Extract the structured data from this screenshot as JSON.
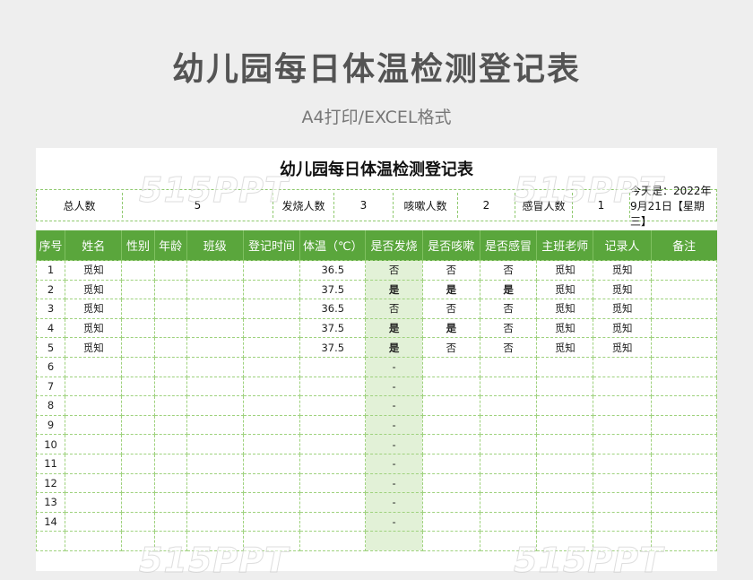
{
  "header": {
    "main_title": "幼儿园每日体温检测登记表",
    "sub_title": "A4打印/EXCEL格式"
  },
  "sheet": {
    "title": "幼儿园每日体温检测登记表",
    "summary": {
      "total_label": "总人数",
      "total_value": "5",
      "fever_label": "发烧人数",
      "fever_value": "3",
      "cough_label": "咳嗽人数",
      "cough_value": "2",
      "cold_label": "感冒人数",
      "cold_value": "1",
      "today_text": "今天是：2022年9月21日【星期三】"
    },
    "columns": [
      "序号",
      "姓名",
      "性别",
      "年龄",
      "班级",
      "登记时间",
      "体温（℃）",
      "是否发烧",
      "是否咳嗽",
      "是否感冒",
      "主班老师",
      "记录人",
      "备注"
    ],
    "rows": [
      {
        "no": "1",
        "name": "觅知",
        "gender": "",
        "age": "",
        "class": "",
        "time": "",
        "temp": "36.5",
        "fever": "否",
        "cough": "否",
        "cold": "否",
        "teacher": "觅知",
        "recorder": "觅知",
        "note": ""
      },
      {
        "no": "2",
        "name": "觅知",
        "gender": "",
        "age": "",
        "class": "",
        "time": "",
        "temp": "37.5",
        "fever": "是",
        "cough": "是",
        "cold": "是",
        "teacher": "觅知",
        "recorder": "觅知",
        "note": ""
      },
      {
        "no": "3",
        "name": "觅知",
        "gender": "",
        "age": "",
        "class": "",
        "time": "",
        "temp": "36.5",
        "fever": "否",
        "cough": "否",
        "cold": "否",
        "teacher": "觅知",
        "recorder": "觅知",
        "note": ""
      },
      {
        "no": "4",
        "name": "觅知",
        "gender": "",
        "age": "",
        "class": "",
        "time": "",
        "temp": "37.5",
        "fever": "是",
        "cough": "是",
        "cold": "否",
        "teacher": "觅知",
        "recorder": "觅知",
        "note": ""
      },
      {
        "no": "5",
        "name": "觅知",
        "gender": "",
        "age": "",
        "class": "",
        "time": "",
        "temp": "37.5",
        "fever": "是",
        "cough": "否",
        "cold": "否",
        "teacher": "觅知",
        "recorder": "觅知",
        "note": ""
      },
      {
        "no": "6",
        "name": "",
        "gender": "",
        "age": "",
        "class": "",
        "time": "",
        "temp": "",
        "fever": "-",
        "cough": "",
        "cold": "",
        "teacher": "",
        "recorder": "",
        "note": ""
      },
      {
        "no": "7",
        "name": "",
        "gender": "",
        "age": "",
        "class": "",
        "time": "",
        "temp": "",
        "fever": "-",
        "cough": "",
        "cold": "",
        "teacher": "",
        "recorder": "",
        "note": ""
      },
      {
        "no": "8",
        "name": "",
        "gender": "",
        "age": "",
        "class": "",
        "time": "",
        "temp": "",
        "fever": "-",
        "cough": "",
        "cold": "",
        "teacher": "",
        "recorder": "",
        "note": ""
      },
      {
        "no": "9",
        "name": "",
        "gender": "",
        "age": "",
        "class": "",
        "time": "",
        "temp": "",
        "fever": "-",
        "cough": "",
        "cold": "",
        "teacher": "",
        "recorder": "",
        "note": ""
      },
      {
        "no": "10",
        "name": "",
        "gender": "",
        "age": "",
        "class": "",
        "time": "",
        "temp": "",
        "fever": "-",
        "cough": "",
        "cold": "",
        "teacher": "",
        "recorder": "",
        "note": ""
      },
      {
        "no": "11",
        "name": "",
        "gender": "",
        "age": "",
        "class": "",
        "time": "",
        "temp": "",
        "fever": "-",
        "cough": "",
        "cold": "",
        "teacher": "",
        "recorder": "",
        "note": ""
      },
      {
        "no": "12",
        "name": "",
        "gender": "",
        "age": "",
        "class": "",
        "time": "",
        "temp": "",
        "fever": "-",
        "cough": "",
        "cold": "",
        "teacher": "",
        "recorder": "",
        "note": ""
      },
      {
        "no": "13",
        "name": "",
        "gender": "",
        "age": "",
        "class": "",
        "time": "",
        "temp": "",
        "fever": "-",
        "cough": "",
        "cold": "",
        "teacher": "",
        "recorder": "",
        "note": ""
      },
      {
        "no": "14",
        "name": "",
        "gender": "",
        "age": "",
        "class": "",
        "time": "",
        "temp": "",
        "fever": "-",
        "cough": "",
        "cold": "",
        "teacher": "",
        "recorder": "",
        "note": ""
      },
      {
        "no": "",
        "name": "",
        "gender": "",
        "age": "",
        "class": "",
        "time": "",
        "temp": "",
        "fever": "",
        "cough": "",
        "cold": "",
        "teacher": "",
        "recorder": "",
        "note": ""
      }
    ]
  },
  "watermark": {
    "text": "515PPT"
  },
  "colors": {
    "header_green": "#5aa63c",
    "highlight_red": "#e02020",
    "fever_column_bg": "#e2f1d7"
  }
}
